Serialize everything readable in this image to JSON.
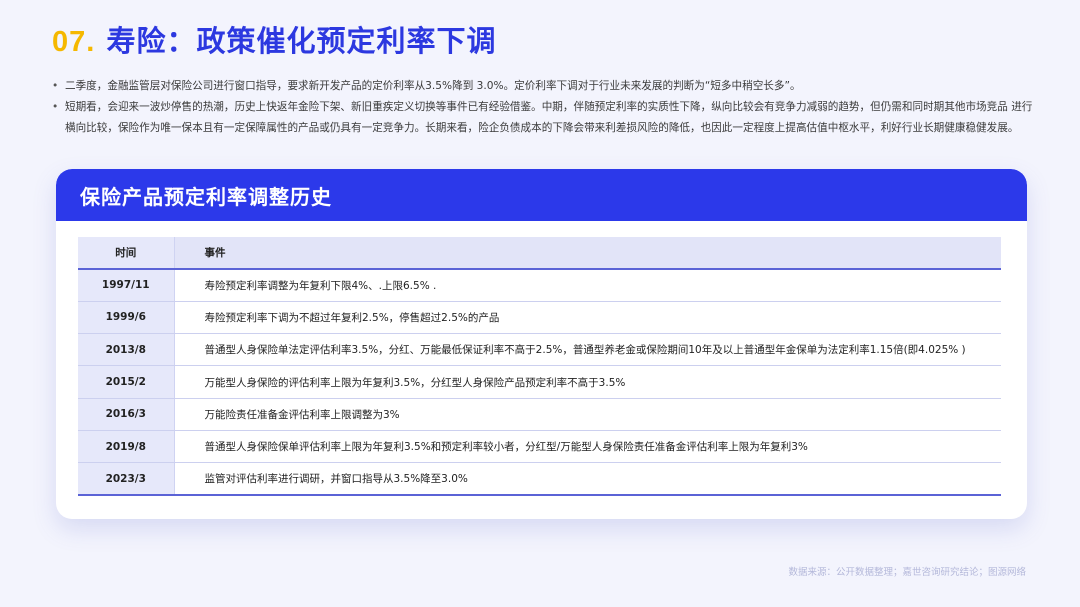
{
  "header": {
    "number": "07.",
    "title": "寿险：政策催化预定利率下调"
  },
  "bullets": [
    "二季度，金融监管层对保险公司进行窗口指导，要求新开发产品的定价利率从3.5%降到 3.0%。定价利率下调对于行业未来发展的判断为“短多中稍空长多”。",
    "短期看，会迎来一波炒停售的热潮，历史上快返年金险下架、新旧重疾定义切换等事件已有经验借鉴。中期，伴随预定利率的实质性下降，纵向比较会有竞争力减弱的趋势，但仍需和同时期其他市场竞品 进行横向比较，保险作为唯一保本且有一定保障属性的产品或仍具有一定竞争力。长期来看，险企负债成本的下降会带来利差损风险的降低，也因此一定程度上提高估值中枢水平，利好行业长期健康稳健发展。"
  ],
  "card": {
    "title": "保险产品预定利率调整历史"
  },
  "table": {
    "headers": [
      "时间",
      "事件"
    ],
    "rows": [
      [
        "1997/11",
        "寿险预定利率调整为年复利下限4%、.上限6.5% ."
      ],
      [
        "1999/6",
        "寿险预定利率下调为不超过年复利2.5%，停售超过2.5%的产品"
      ],
      [
        "2013/8",
        "普通型人身保险单法定评估利率3.5%，分红、万能最低保证利率不高于2.5%，普通型养老金或保险期间10年及以上普通型年金保单为法定利率1.15倍(即4.025% )"
      ],
      [
        "2015/2",
        "万能型人身保险的评估利率上限为年复利3.5%，分红型人身保险产品预定利率不高于3.5%"
      ],
      [
        "2016/3",
        "万能险责任准备金评估利率上限调整为3%"
      ],
      [
        "2019/8",
        "普通型人身保险保单评估利率上限为年复利3.5%和预定利率较小者，分红型/万能型人身保险责任准备金评估利率上限为年复利3%"
      ],
      [
        "2023/3",
        "监管对评估利率进行调研，并窗口指导从3.5%降至3.0%"
      ]
    ]
  },
  "footer": {
    "source": "数据来源：公开数据整理；嘉世咨询研究结论；图源网络"
  },
  "colors": {
    "accent": "#2c39ea",
    "number": "#f5b800",
    "header_row": "#e2e4f8",
    "background": "#f3f4fd"
  }
}
